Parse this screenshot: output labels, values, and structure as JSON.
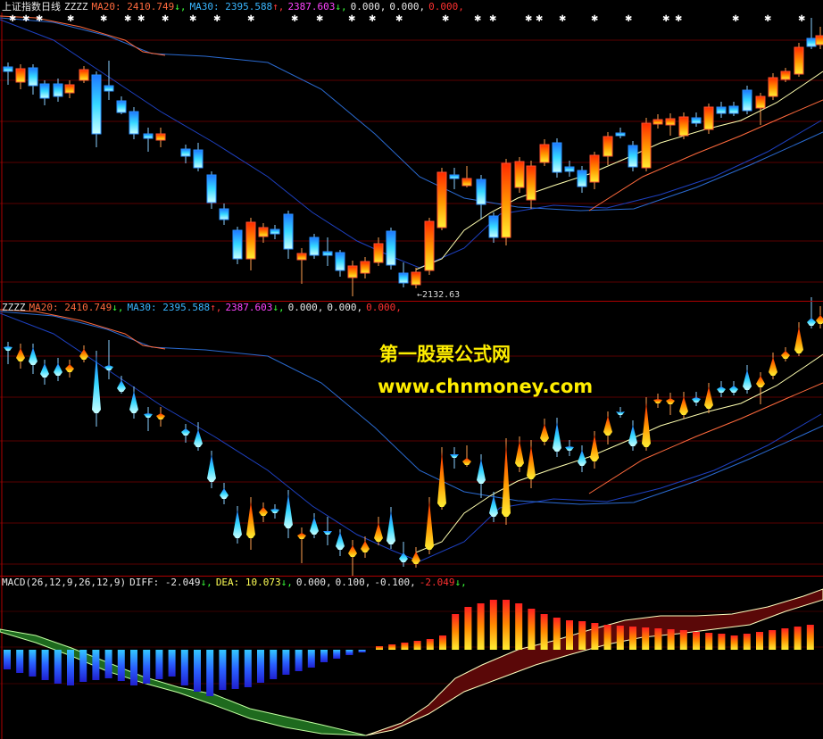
{
  "pane1": {
    "title": "上证指数",
    "period": "日线",
    "indicator": "ZZZZ",
    "ma20_label": "MA20: 2410.749",
    "ma20_arrow": "↓,",
    "ma30_label": "MA30: 2395.588",
    "ma30_arrow": "↑,",
    "v3": "2387.603",
    "v3_arrow": "↓,",
    "v4": "0.000,",
    "v5": "0.000,",
    "v6": "0.000,",
    "low_label": "2132.63"
  },
  "pane2": {
    "indicator": "ZZZZ",
    "ma20_label": "MA20: 2410.749",
    "ma20_arrow": "↓,",
    "ma30_label": "MA30: 2395.588",
    "ma30_arrow": "↑,",
    "v3": "2387.603",
    "v3_arrow": "↓,",
    "v4": "0.000,",
    "v5": "0.000,",
    "v6": "0.000,"
  },
  "pane3": {
    "indicator": "MACD(26,12,9,26,12,9)",
    "diff_label": "DIFF: -2.049",
    "diff_arrow": "↓,",
    "dea_label": "DEA: 10.073",
    "dea_arrow": "↓,",
    "v1": "0.000,",
    "v2": "0.100,",
    "v3": "-0.100,",
    "v4": "-2.049",
    "v4_arrow": "↓,"
  },
  "watermark": {
    "line1": "第一股票公式网",
    "line2": "www.chnmoney.com"
  },
  "colors": {
    "background": "#000000",
    "grid": "#8b0000",
    "up_fill": "#ff4000",
    "down_fill": "#32c8ff",
    "ma_short": "#ffffa0",
    "ma_mid": "#ff6a3d",
    "ma_long": "#1e50d0"
  }
}
